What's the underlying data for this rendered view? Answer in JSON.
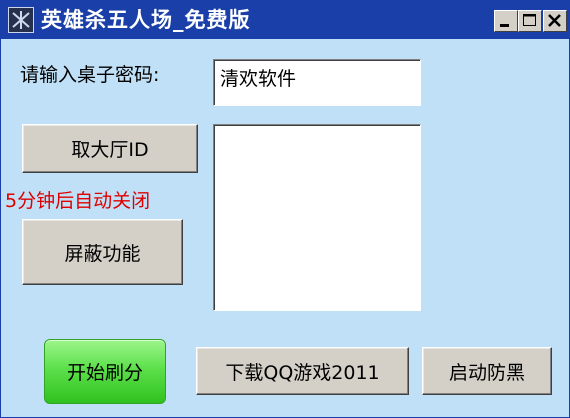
{
  "window": {
    "title": "英雄杀五人场_免费版"
  },
  "titlebar": {
    "icon": "app-logo-icon",
    "buttons": [
      "minimize-icon",
      "maximize-icon",
      "close-icon"
    ]
  },
  "form": {
    "password_label": "请输入桌子密码:",
    "password_value": "清欢软件",
    "get_hall_id_label": "取大厅ID",
    "auto_close_notice": "5分钟后自动关闭",
    "block_label": "屏蔽功能",
    "output_text": ""
  },
  "bottom": {
    "start_label": "开始刷分",
    "download_label": "下载QQ游戏2011",
    "anti_block_label": "启动防黑"
  },
  "colors": {
    "titlebar": "#1a3fa8",
    "background": "#bfe0f6",
    "notice": "#e00000",
    "start_button": "#4fd83f"
  }
}
